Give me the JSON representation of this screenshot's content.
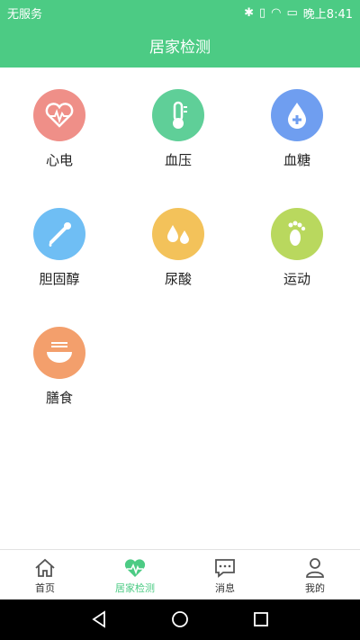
{
  "status": {
    "carrier": "无服务",
    "time": "晚上8:41"
  },
  "header": {
    "title": "居家检测"
  },
  "colors": {
    "accent": "#4ccb84"
  },
  "items": [
    {
      "label": "心电",
      "icon": "heart-pulse-icon",
      "color": "#ef8f88"
    },
    {
      "label": "血压",
      "icon": "thermometer-icon",
      "color": "#5fcf98"
    },
    {
      "label": "血糖",
      "icon": "blood-drop-plus-icon",
      "color": "#6f9ef0"
    },
    {
      "label": "胆固醇",
      "icon": "dropper-icon",
      "color": "#6fbef4"
    },
    {
      "label": "尿酸",
      "icon": "drops-icon",
      "color": "#f3c25a"
    },
    {
      "label": "运动",
      "icon": "footprint-icon",
      "color": "#b9d85e"
    },
    {
      "label": "膳食",
      "icon": "bowl-icon",
      "color": "#f39f6c"
    }
  ],
  "tabs": [
    {
      "label": "首页",
      "icon": "home-icon",
      "active": false
    },
    {
      "label": "居家检测",
      "icon": "heart-pulse-icon",
      "active": true
    },
    {
      "label": "消息",
      "icon": "message-icon",
      "active": false
    },
    {
      "label": "我的",
      "icon": "user-icon",
      "active": false
    }
  ]
}
